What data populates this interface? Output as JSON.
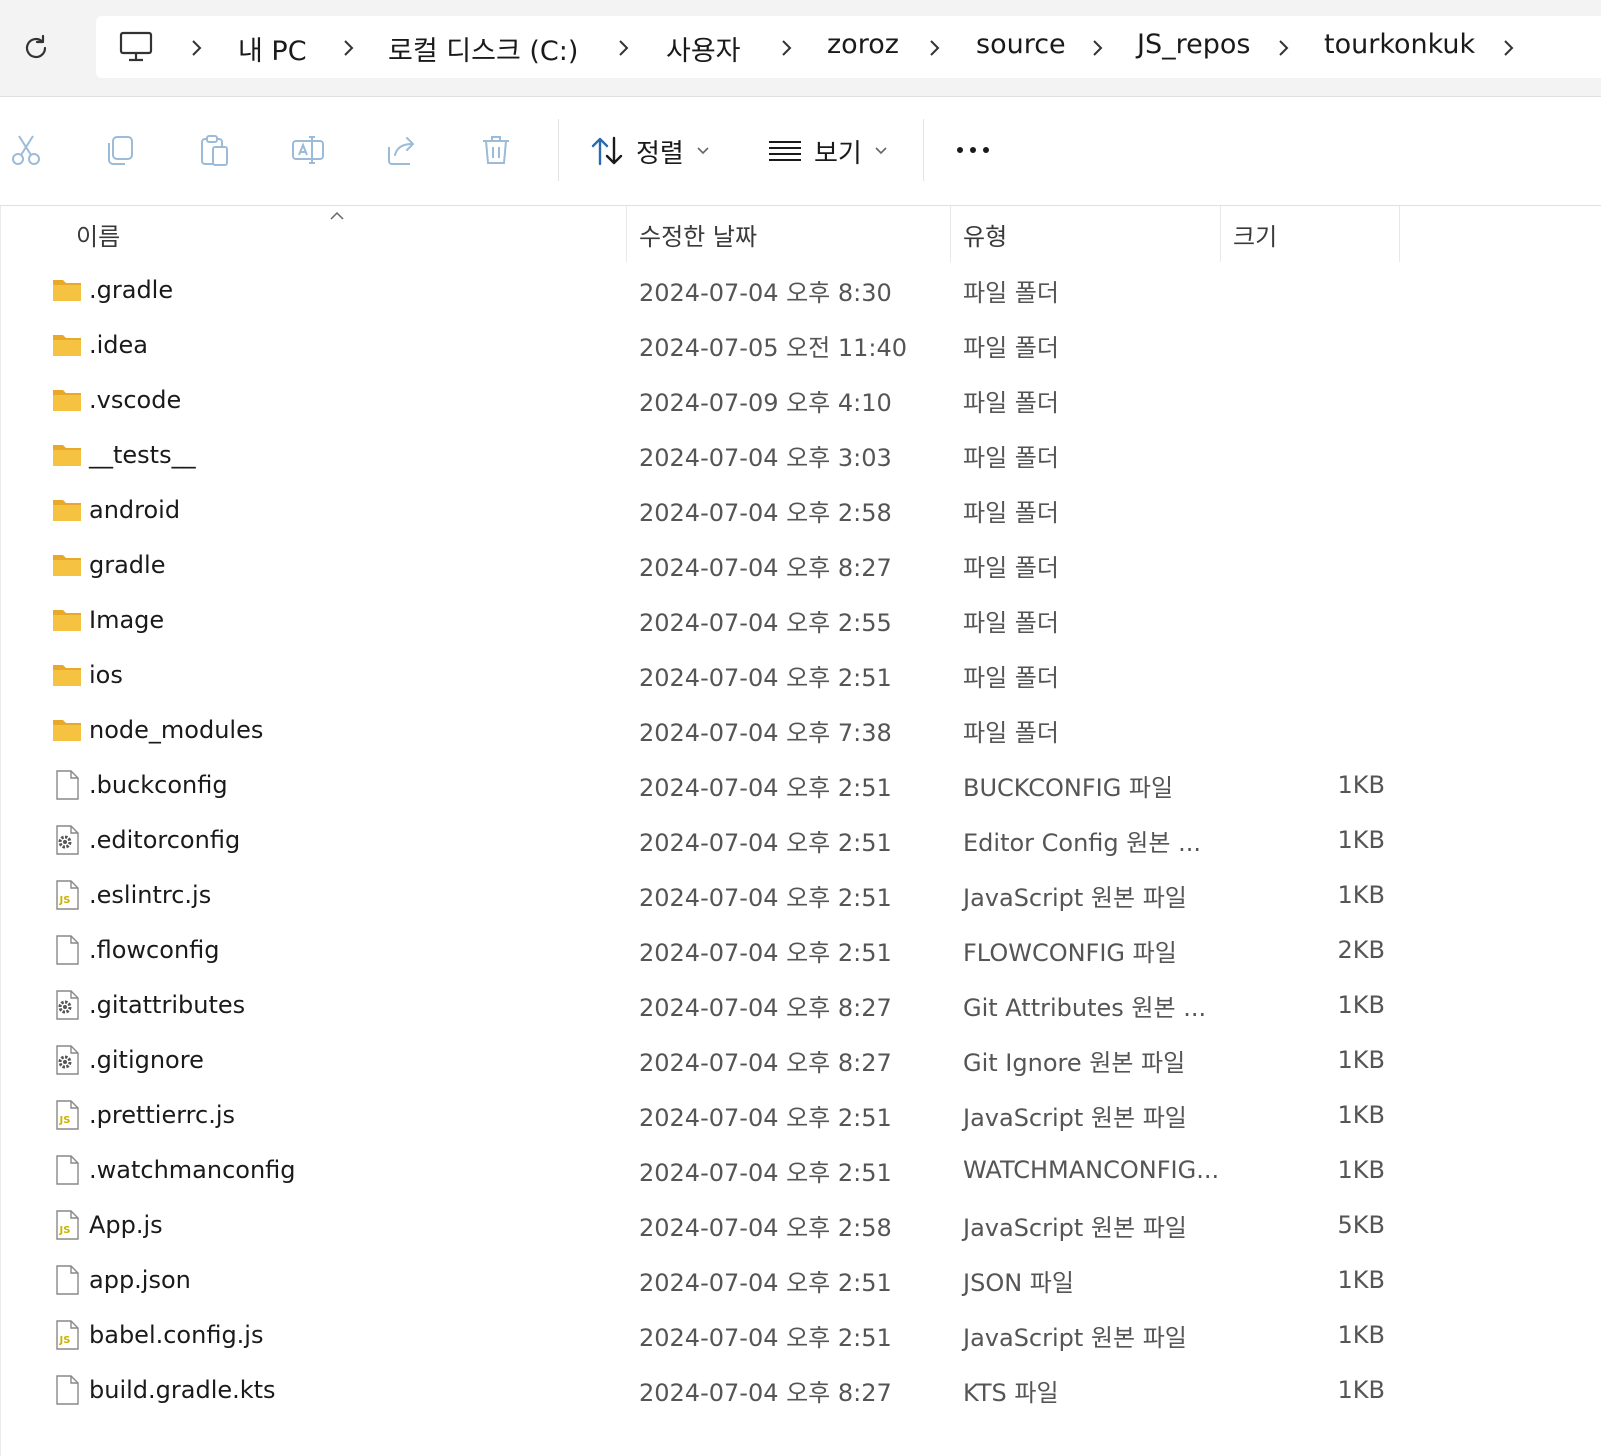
{
  "address_bar": {
    "crumbs": [
      "내 PC",
      "로컬 디스크 (C:)",
      "사용자",
      "zoroz",
      "source",
      "JS_repos",
      "tourkonkuk"
    ]
  },
  "toolbar": {
    "sort_label": "정렬",
    "view_label": "보기"
  },
  "columns": {
    "name": "이름",
    "date": "수정한 날짜",
    "type": "유형",
    "size": "크기"
  },
  "files": [
    {
      "name": ".gradle",
      "date": "2024-07-04 오후 8:30",
      "type": "파일 폴더",
      "size": "",
      "icon": "folder"
    },
    {
      "name": ".idea",
      "date": "2024-07-05 오전 11:40",
      "type": "파일 폴더",
      "size": "",
      "icon": "folder"
    },
    {
      "name": ".vscode",
      "date": "2024-07-09 오후 4:10",
      "type": "파일 폴더",
      "size": "",
      "icon": "folder"
    },
    {
      "name": "__tests__",
      "date": "2024-07-04 오후 3:03",
      "type": "파일 폴더",
      "size": "",
      "icon": "folder"
    },
    {
      "name": "android",
      "date": "2024-07-04 오후 2:58",
      "type": "파일 폴더",
      "size": "",
      "icon": "folder"
    },
    {
      "name": "gradle",
      "date": "2024-07-04 오후 8:27",
      "type": "파일 폴더",
      "size": "",
      "icon": "folder"
    },
    {
      "name": "Image",
      "date": "2024-07-04 오후 2:55",
      "type": "파일 폴더",
      "size": "",
      "icon": "folder"
    },
    {
      "name": "ios",
      "date": "2024-07-04 오후 2:51",
      "type": "파일 폴더",
      "size": "",
      "icon": "folder"
    },
    {
      "name": "node_modules",
      "date": "2024-07-04 오후 7:38",
      "type": "파일 폴더",
      "size": "",
      "icon": "folder"
    },
    {
      "name": ".buckconfig",
      "date": "2024-07-04 오후 2:51",
      "type": "BUCKCONFIG 파일",
      "size": "1KB",
      "icon": "file"
    },
    {
      "name": ".editorconfig",
      "date": "2024-07-04 오후 2:51",
      "type": "Editor Config 원본 ...",
      "size": "1KB",
      "icon": "gear-file"
    },
    {
      "name": ".eslintrc.js",
      "date": "2024-07-04 오후 2:51",
      "type": "JavaScript 원본 파일",
      "size": "1KB",
      "icon": "js-file"
    },
    {
      "name": ".flowconfig",
      "date": "2024-07-04 오후 2:51",
      "type": "FLOWCONFIG 파일",
      "size": "2KB",
      "icon": "file"
    },
    {
      "name": ".gitattributes",
      "date": "2024-07-04 오후 8:27",
      "type": "Git Attributes 원본 ...",
      "size": "1KB",
      "icon": "gear-file"
    },
    {
      "name": ".gitignore",
      "date": "2024-07-04 오후 8:27",
      "type": "Git Ignore 원본 파일",
      "size": "1KB",
      "icon": "gear-file"
    },
    {
      "name": ".prettierrc.js",
      "date": "2024-07-04 오후 2:51",
      "type": "JavaScript 원본 파일",
      "size": "1KB",
      "icon": "js-file"
    },
    {
      "name": ".watchmanconfig",
      "date": "2024-07-04 오후 2:51",
      "type": "WATCHMANCONFIG...",
      "size": "1KB",
      "icon": "file"
    },
    {
      "name": "App.js",
      "date": "2024-07-04 오후 2:58",
      "type": "JavaScript 원본 파일",
      "size": "5KB",
      "icon": "js-file"
    },
    {
      "name": "app.json",
      "date": "2024-07-04 오후 2:51",
      "type": "JSON 파일",
      "size": "1KB",
      "icon": "file"
    },
    {
      "name": "babel.config.js",
      "date": "2024-07-04 오후 2:51",
      "type": "JavaScript 원본 파일",
      "size": "1KB",
      "icon": "js-file"
    },
    {
      "name": "build.gradle.kts",
      "date": "2024-07-04 오후 8:27",
      "type": "KTS 파일",
      "size": "1KB",
      "icon": "file"
    }
  ],
  "colors": {
    "folder": "#f5c242",
    "folder_dark": "#e8a92b",
    "accent": "#2b6cb0",
    "disabled_icon": "#9bbbd8"
  }
}
